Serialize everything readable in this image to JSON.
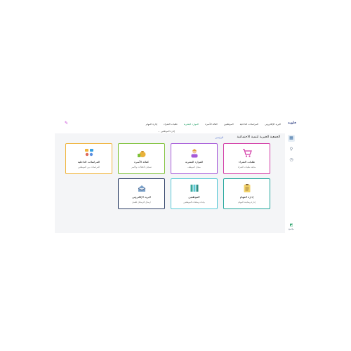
{
  "sidebar": {
    "logo": "فلويه",
    "bottom_label": "مجتمع"
  },
  "nav": {
    "items": [
      {
        "label": "البريد الإلكتروني",
        "active": false
      },
      {
        "label": "المراسلات الداخلية",
        "active": false
      },
      {
        "label": "الموظفين",
        "active": false
      },
      {
        "label": "كفالة الأسرة",
        "active": false
      },
      {
        "label": "الموارد البشرية",
        "active": true
      },
      {
        "label": "طلبات الشراء",
        "active": false
      },
      {
        "label": "إدارة المهام",
        "active": false
      }
    ],
    "sub_item": "إدارة الموظفين"
  },
  "main": {
    "heading": "الجمعية الخيرية لتنمية الاجتماعية",
    "breadcrumb": "الرئيسي"
  },
  "cards": [
    {
      "title": "طلبات الشراء",
      "desc": "متابعة طلبات الشراء",
      "border": "#d23aa6",
      "icon": "shopping-cart-icon"
    },
    {
      "title": "الموارد البشرية",
      "desc": "سجل الموظف",
      "border": "#a65ad8",
      "icon": "employee-icon"
    },
    {
      "title": "كفالة الأسرة",
      "desc": "تسجيل الكفالات والأسر",
      "border": "#7fc23a",
      "icon": "money-bag-icon"
    },
    {
      "title": "المراسلات الداخلية",
      "desc": "المراسلات بين الموظفين",
      "border": "#f0b43a",
      "icon": "chat-icon"
    },
    {
      "title": "إدارة المهام",
      "desc": "إدارة ومتابعة المهام",
      "border": "#1fa59b",
      "icon": "clipboard-icon"
    },
    {
      "title": "الموظفين",
      "desc": "بيانات وملفات الموظفين",
      "border": "#58c9d6",
      "icon": "binders-icon"
    },
    {
      "title": "البريد الإلكتروني",
      "desc": "ارسال الرسائل للعمل",
      "border": "#2c3e66",
      "icon": "mail-tray-icon"
    }
  ]
}
